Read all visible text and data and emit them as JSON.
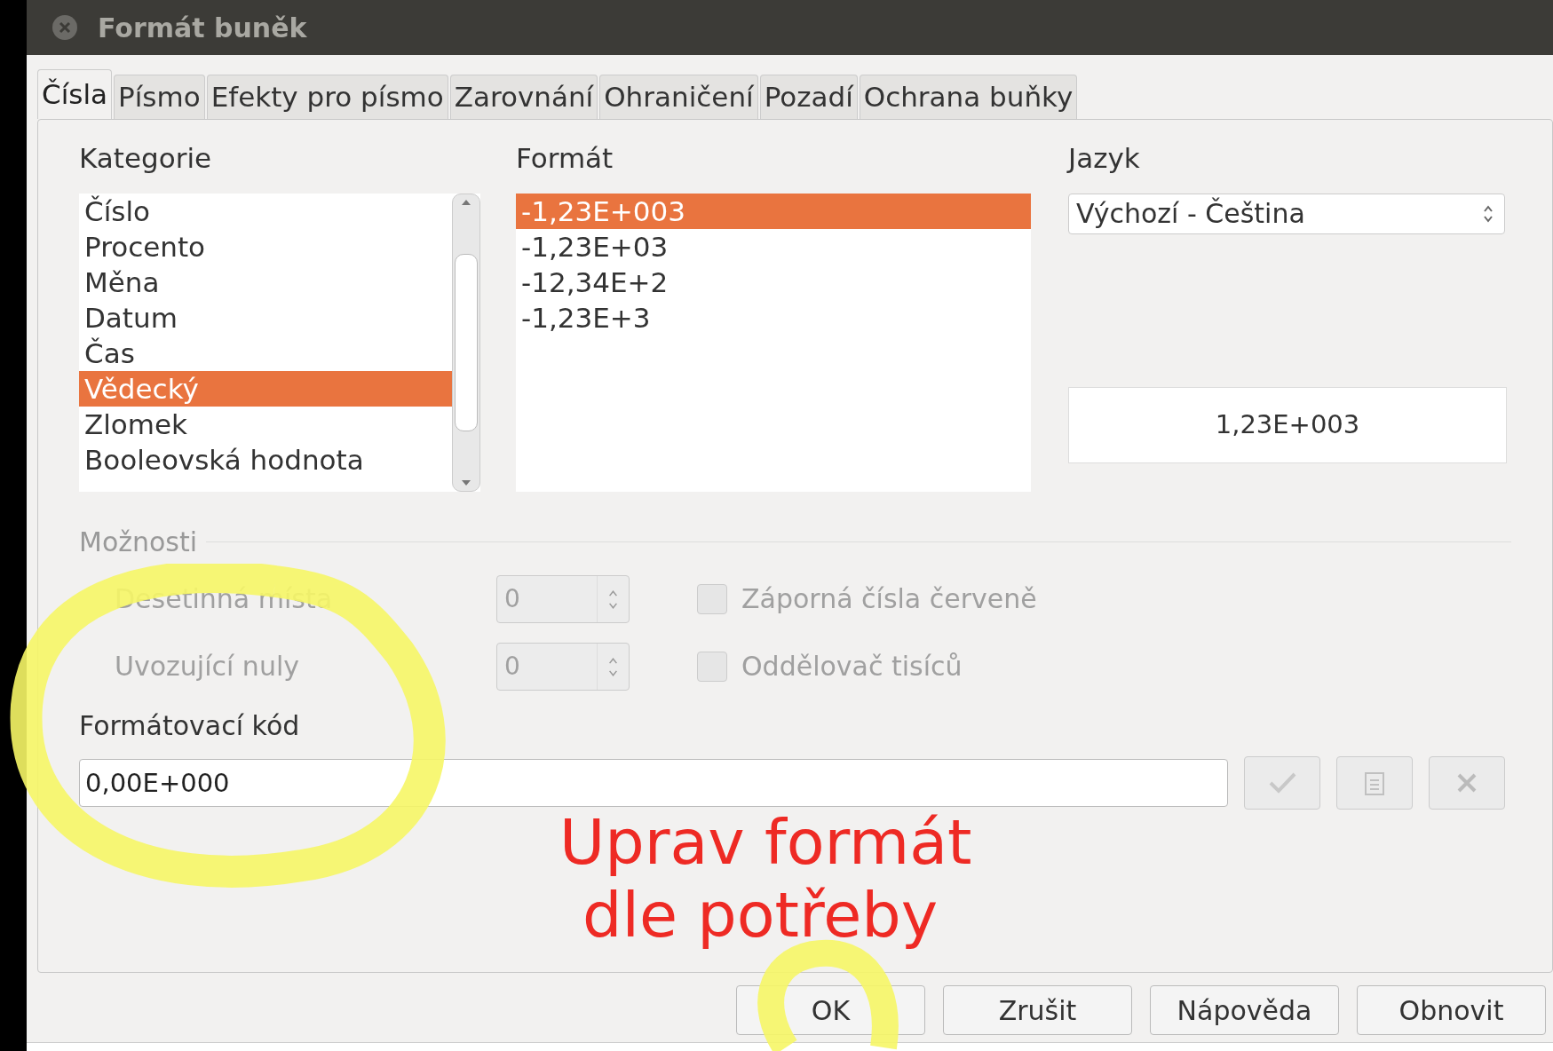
{
  "window": {
    "title": "Formát buněk"
  },
  "tabs": [
    {
      "label": "Čísla",
      "selected": true
    },
    {
      "label": "Písmo",
      "selected": false
    },
    {
      "label": "Efekty pro písmo",
      "selected": false
    },
    {
      "label": "Zarovnání",
      "selected": false
    },
    {
      "label": "Ohraničení",
      "selected": false
    },
    {
      "label": "Pozadí",
      "selected": false
    },
    {
      "label": "Ochrana buňky",
      "selected": false
    }
  ],
  "category": {
    "label": "Kategorie",
    "items": [
      {
        "label": "Číslo",
        "selected": false
      },
      {
        "label": "Procento",
        "selected": false
      },
      {
        "label": "Měna",
        "selected": false
      },
      {
        "label": "Datum",
        "selected": false
      },
      {
        "label": "Čas",
        "selected": false
      },
      {
        "label": "Vědecký",
        "selected": true
      },
      {
        "label": "Zlomek",
        "selected": false
      },
      {
        "label": "Booleovská hodnota",
        "selected": false
      }
    ]
  },
  "format": {
    "label": "Formát",
    "items": [
      {
        "label": "-1,23E+003",
        "selected": true
      },
      {
        "label": "-1,23E+03",
        "selected": false
      },
      {
        "label": "-12,34E+2",
        "selected": false
      },
      {
        "label": "-1,23E+3",
        "selected": false
      }
    ]
  },
  "language": {
    "label": "Jazyk",
    "value": "Výchozí - Čeština"
  },
  "preview": "1,23E+003",
  "options": {
    "title": "Možnosti",
    "spins": [
      {
        "label": "Desetinná místa",
        "value": "0",
        "disabled": true
      },
      {
        "label": "Uvozující nuly",
        "value": "0",
        "disabled": true
      }
    ],
    "checkboxes": [
      {
        "label": "Záporná čísla červeně",
        "checked": false,
        "disabled": true
      },
      {
        "label": "Oddělovač tisíců",
        "checked": false,
        "disabled": true
      }
    ]
  },
  "format_code": {
    "label": "Formátovací kód",
    "value": "0,00E+000"
  },
  "annotation": {
    "lines": [
      "Uprav formát",
      "dle potřeby"
    ]
  },
  "buttons": [
    "OK",
    "Zrušit",
    "Nápověda",
    "Obnovit"
  ]
}
